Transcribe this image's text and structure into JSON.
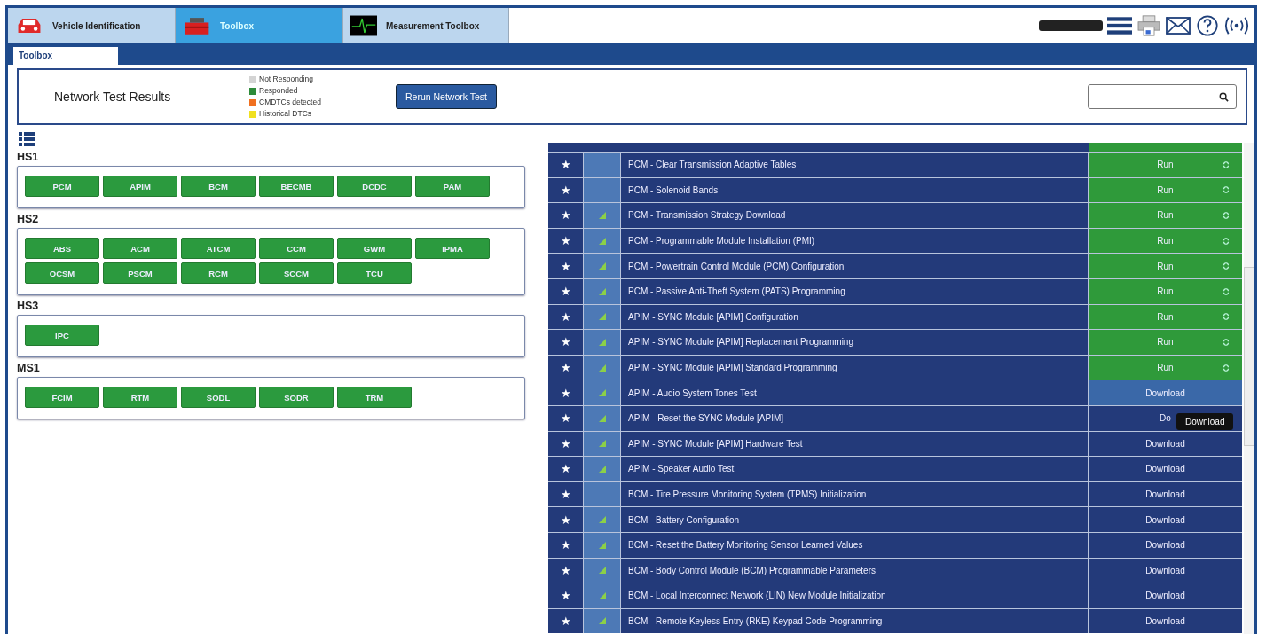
{
  "top_tabs": [
    {
      "label": "Vehicle Identification",
      "selected": false
    },
    {
      "label": "Toolbox",
      "selected": true
    },
    {
      "label": "Measurement Toolbox",
      "selected": false
    }
  ],
  "sub_tabs": [
    {
      "label": "Toolbox",
      "selected": true
    }
  ],
  "network": {
    "title": "Network Test Results",
    "legend": [
      {
        "label": "Not Responding",
        "color": "#d4d4d4"
      },
      {
        "label": "Responded",
        "color": "#2e8b3a"
      },
      {
        "label": "CMDTCs detected",
        "color": "#f07020"
      },
      {
        "label": "Historical DTCs",
        "color": "#f0e020"
      }
    ],
    "rerun_button": "Rerun Network Test"
  },
  "buses": [
    {
      "name": "HS1",
      "modules": [
        "PCM",
        "APIM",
        "BCM",
        "BECMB",
        "DCDC",
        "PAM"
      ]
    },
    {
      "name": "HS2",
      "modules": [
        "ABS",
        "ACM",
        "ATCM",
        "CCM",
        "GWM",
        "IPMA",
        "OCSM",
        "PSCM",
        "RCM",
        "SCCM",
        "TCU"
      ]
    },
    {
      "name": "HS3",
      "modules": [
        "IPC"
      ]
    },
    {
      "name": "MS1",
      "modules": [
        "FCIM",
        "RTM",
        "SODL",
        "SODR",
        "TRM"
      ]
    }
  ],
  "tools": [
    {
      "name": "PCM - Clear Transmission Adaptive Tables",
      "signal": false,
      "kind": "run",
      "action": "Run",
      "hovered": false
    },
    {
      "name": "PCM - Solenoid Bands",
      "signal": false,
      "kind": "run",
      "action": "Run",
      "hovered": false
    },
    {
      "name": "PCM - Transmission Strategy Download",
      "signal": true,
      "kind": "run",
      "action": "Run",
      "hovered": false
    },
    {
      "name": "PCM - Programmable Module Installation (PMI)",
      "signal": true,
      "kind": "run",
      "action": "Run",
      "hovered": false
    },
    {
      "name": "PCM - Powertrain Control Module (PCM) Configuration",
      "signal": true,
      "kind": "run",
      "action": "Run",
      "hovered": false
    },
    {
      "name": "PCM - Passive Anti-Theft System (PATS) Programming",
      "signal": true,
      "kind": "run",
      "action": "Run",
      "hovered": false
    },
    {
      "name": "APIM - SYNC Module [APIM] Configuration",
      "signal": true,
      "kind": "run",
      "action": "Run",
      "hovered": false
    },
    {
      "name": "APIM - SYNC Module [APIM] Replacement Programming",
      "signal": true,
      "kind": "run",
      "action": "Run",
      "hovered": false
    },
    {
      "name": "APIM - SYNC Module [APIM] Standard Programming",
      "signal": true,
      "kind": "run",
      "action": "Run",
      "hovered": false
    },
    {
      "name": "APIM - Audio System Tones Test",
      "signal": true,
      "kind": "download",
      "action": "Download",
      "hovered": true
    },
    {
      "name": "APIM - Reset the SYNC Module [APIM]",
      "signal": true,
      "kind": "download",
      "action": "Do",
      "hovered": false,
      "tooltip": "Download"
    },
    {
      "name": "APIM - SYNC Module [APIM] Hardware Test",
      "signal": true,
      "kind": "download",
      "action": "Download",
      "hovered": false
    },
    {
      "name": "APIM - Speaker Audio Test",
      "signal": true,
      "kind": "download",
      "action": "Download",
      "hovered": false
    },
    {
      "name": "BCM - Tire Pressure Monitoring System (TPMS) Initialization",
      "signal": false,
      "kind": "download",
      "action": "Download",
      "hovered": false
    },
    {
      "name": "BCM - Battery Configuration",
      "signal": true,
      "kind": "download",
      "action": "Download",
      "hovered": false
    },
    {
      "name": "BCM - Reset the Battery Monitoring Sensor Learned Values",
      "signal": true,
      "kind": "download",
      "action": "Download",
      "hovered": false
    },
    {
      "name": "BCM - Body Control Module (BCM) Programmable Parameters",
      "signal": true,
      "kind": "download",
      "action": "Download",
      "hovered": false
    },
    {
      "name": "BCM - Local Interconnect Network (LIN) New Module Initialization",
      "signal": true,
      "kind": "download",
      "action": "Download",
      "hovered": false
    },
    {
      "name": "BCM - Remote Keyless Entry (RKE) Keypad Code Programming",
      "signal": true,
      "kind": "download",
      "action": "Download",
      "hovered": false
    }
  ],
  "star_glyph": "★"
}
